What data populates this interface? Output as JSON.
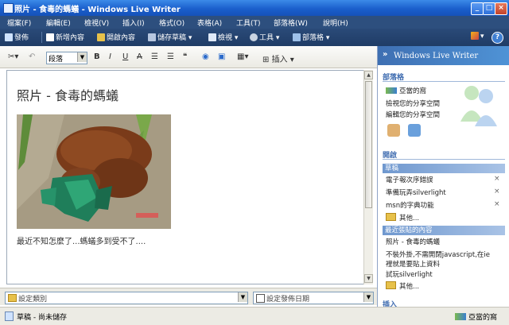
{
  "window": {
    "title": "照片 - 食毒的螞蟻 - Windows Live Writer",
    "minimize_label": "_",
    "maximize_label": "□",
    "close_label": "×"
  },
  "menu": [
    "檔案(F)",
    "編輯(E)",
    "檢視(V)",
    "插入(I)",
    "格式(O)",
    "表格(A)",
    "工具(T)",
    "部落格(W)",
    "說明(H)"
  ],
  "toolbar": {
    "publish": "發佈",
    "new": "新增內容",
    "open": "開啟內容",
    "save_draft": "儲存草稿",
    "preview": "檢視",
    "tools": "工具",
    "blogs": "部落格",
    "help": "?"
  },
  "format": {
    "style_value": "段落",
    "bold": "B",
    "italic": "I",
    "underline": "U",
    "strike": "A",
    "insert_label": "插入"
  },
  "editor": {
    "post_title": "照片 - 食毒的螞蟻",
    "body_text": "最近不知怎麼了...螞蟻多到受不了...."
  },
  "bottom": {
    "category_placeholder": "設定類別",
    "date_placeholder": "設定發佈日期"
  },
  "status": {
    "left": "草稿 - 尚未儲存",
    "right": "亞當的窩"
  },
  "sidebar": {
    "header": "Windows Live Writer",
    "blog_section": "部落格",
    "blog_name": "亞當的窩",
    "blog_links": [
      "檢視您的分享空間",
      "編輯您的分享空間"
    ],
    "open_section": "開啟",
    "drafts_label": "草稿",
    "drafts": [
      "電子報次序錯誤",
      "準備玩弄silverlight",
      "msn的字典功能"
    ],
    "more1": "其他...",
    "recent_label": "最近張貼的內容",
    "recent": [
      "照片 - 食毒的螞蟻",
      "不裝外掛,不需開閉javascript,在ie",
      "裡就是要貼上資料",
      "試玩silverlight"
    ],
    "more2": "其他...",
    "insert_section": "插入",
    "remove_label": "×"
  }
}
